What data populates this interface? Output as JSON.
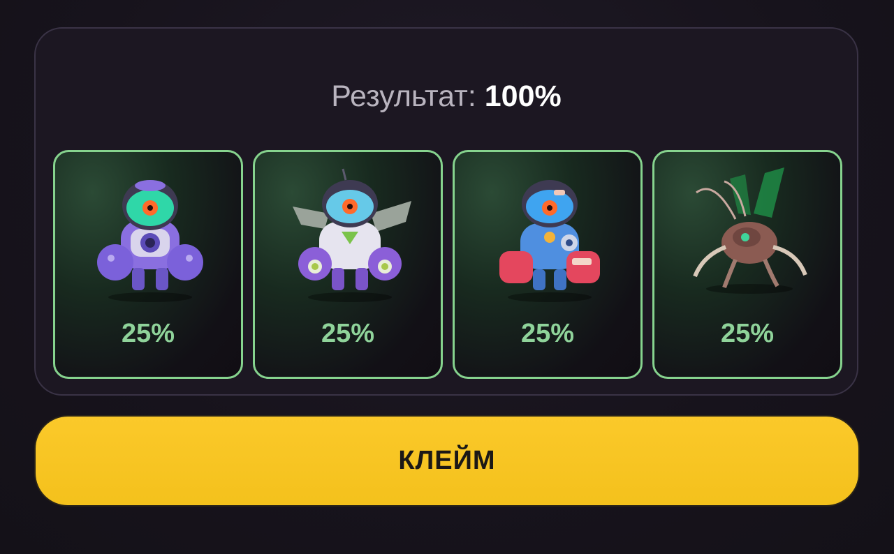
{
  "result": {
    "label": "Результат:",
    "value": "100%"
  },
  "cards": [
    {
      "name": "purple-mech-robot",
      "percent": "25%"
    },
    {
      "name": "winged-mech-robot",
      "percent": "25%"
    },
    {
      "name": "blue-red-mech-robot",
      "percent": "25%"
    },
    {
      "name": "mech-insect-drone",
      "percent": "25%"
    }
  ],
  "claim_button": {
    "label": "КЛЕЙМ"
  },
  "colors": {
    "accent_green": "#86d38e",
    "button_yellow": "#f4c11c",
    "background": "#17131c"
  }
}
